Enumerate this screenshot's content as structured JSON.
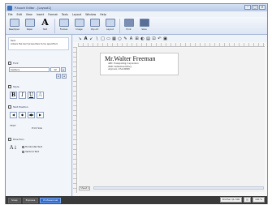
{
  "window": {
    "title": "P-touch Editor - [Layout1]"
  },
  "menu": [
    "File",
    "Edit",
    "View",
    "Insert",
    "Format",
    "Tools",
    "Layout",
    "Window",
    "Help"
  ],
  "ribbon": {
    "items": [
      {
        "label": "New/Open",
        "icon": "new-open-icon"
      },
      {
        "label": "Paper",
        "icon": "paper-icon"
      },
      {
        "label": "Text",
        "icon": "text-icon",
        "glyph": "A"
      },
      {
        "label": "Frames",
        "icon": "frames-icon"
      },
      {
        "label": "Image",
        "icon": "image-icon"
      },
      {
        "label": "Clip Art",
        "icon": "clipart-icon"
      },
      {
        "label": "Layout",
        "icon": "layout-icon"
      },
      {
        "label": "Print",
        "icon": "print-icon"
      },
      {
        "label": "Save",
        "icon": "save-icon"
      }
    ]
  },
  "left_panel": {
    "tip_heading": "Text",
    "tip_text": "Allows the text properties to be specified.",
    "font_section": "Font",
    "font_value": "Century",
    "size_value": "12",
    "style_section": "Style",
    "style_buttons": [
      "B",
      "I",
      "U",
      "A"
    ],
    "position_section": "Text Position",
    "position_buttons": [
      "◀",
      "◆",
      "◀▶",
      "▶"
    ],
    "fit_icon_text": "TEXT",
    "fit_label": "Print Size",
    "direction_section": "Direction",
    "direction_icon": "A↓",
    "direction_options": [
      "Horizontal Text",
      "Vertical Text"
    ]
  },
  "draw_tools": [
    "↘",
    "A",
    "↙",
    "\\",
    "□",
    "▭",
    "▦",
    "○",
    "✎",
    "A",
    "⊞",
    "◐",
    "▤",
    "⊡",
    "↶",
    "▣"
  ],
  "label": {
    "name": "Mr.Walter Freeman",
    "lines": [
      "ABC Transporting Corporation",
      "4000 Cumberland Pkwy",
      "Anytown, USA 99999"
    ]
  },
  "sheet_tab": "Sheet 1",
  "status": {
    "modes": [
      "Snap",
      "Express",
      "Professional"
    ],
    "active_mode": "Professional",
    "right_boxes": [
      "Brother QL-500",
      "|||",
      "100 %"
    ]
  }
}
